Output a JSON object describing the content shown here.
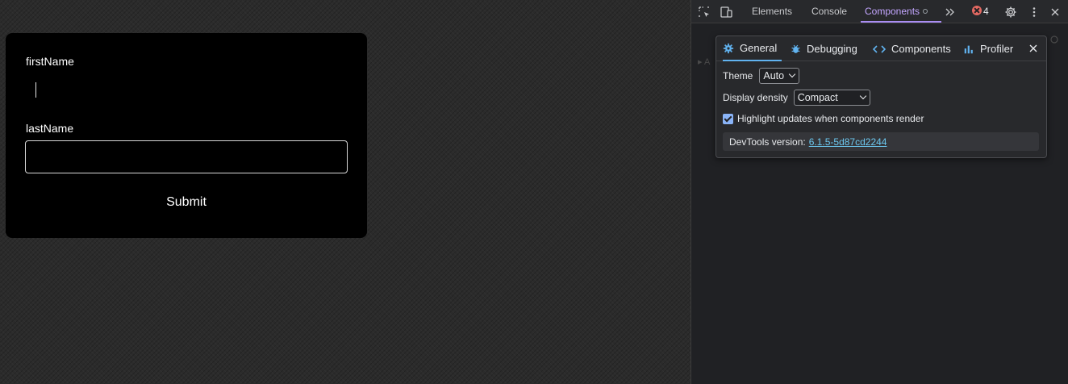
{
  "form": {
    "first_name_label": "firstName",
    "first_name_value": "",
    "last_name_label": "lastName",
    "last_name_value": "",
    "submit_label": "Submit"
  },
  "devtools": {
    "tabs": [
      "Elements",
      "Console",
      "Components"
    ],
    "active_tab": "Components",
    "error_count": "4",
    "accent_color": "#c3a6ff",
    "settings": {
      "tabs": [
        "General",
        "Debugging",
        "Components",
        "Profiler"
      ],
      "active_tab": "General",
      "theme_label": "Theme",
      "theme_value": "Auto",
      "density_label": "Display density",
      "density_value": "Compact",
      "highlight_label": "Highlight updates when components render",
      "highlight_checked": true,
      "version_label": "DevTools version:",
      "version_value": "6.1.5-5d87cd2244"
    }
  }
}
